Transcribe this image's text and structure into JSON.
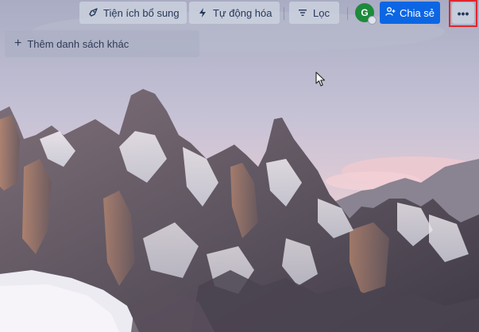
{
  "toolbar": {
    "powerups_label": "Tiện ích bổ sung",
    "automation_label": "Tự động hóa",
    "filter_label": "Lọc",
    "member_initial": "G",
    "share_label": "Chia sẻ",
    "more_label": "•••"
  },
  "board": {
    "add_list_label": "Thêm danh sách khác"
  },
  "icons": {
    "powerups": "rocket-icon",
    "automation": "lightning-icon",
    "filter": "filter-icon",
    "share": "add-person-icon",
    "more": "ellipsis-icon",
    "add": "plus-icon"
  },
  "colors": {
    "share_button": "#0c66e4",
    "avatar": "#1e8a3c",
    "highlight_box": "#e0262c"
  }
}
